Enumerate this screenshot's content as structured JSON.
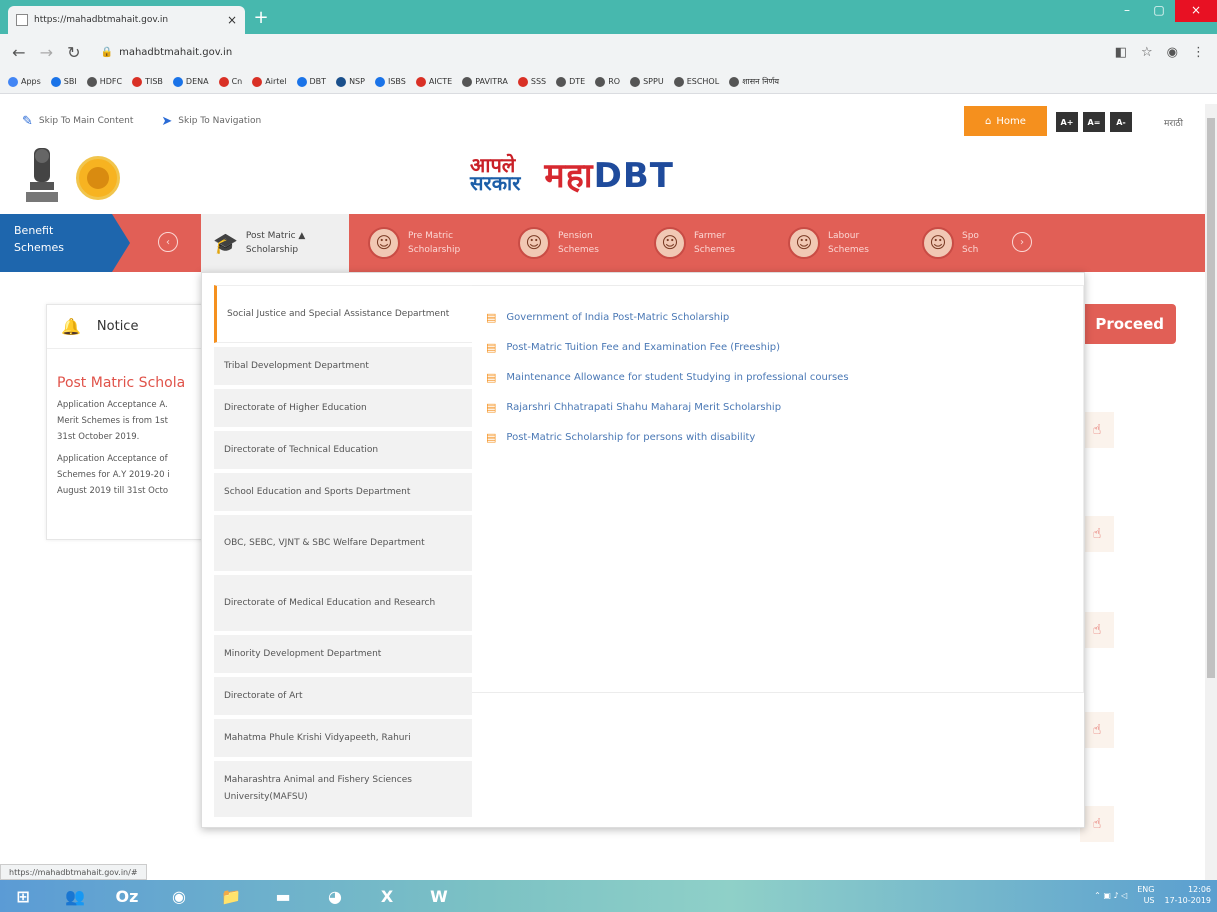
{
  "browser": {
    "tab_title": "https://mahadbtmahait.gov.in",
    "tab_close": "×",
    "new_tab": "+",
    "url": "mahadbtmahait.gov.in",
    "window_controls": [
      "–",
      "▢",
      "×"
    ],
    "bookmarks": [
      {
        "label": "Apps",
        "color": "#4285f4"
      },
      {
        "label": "SBI",
        "color": "#1a73e8"
      },
      {
        "label": "HDFC",
        "color": "#555555"
      },
      {
        "label": "TISB",
        "color": "#d93025"
      },
      {
        "label": "DENA",
        "color": "#1a73e8"
      },
      {
        "label": "Cn",
        "color": "#d93025"
      },
      {
        "label": "Airtel",
        "color": "#d93025"
      },
      {
        "label": "DBT",
        "color": "#1a73e8"
      },
      {
        "label": "NSP",
        "color": "#1a4f8b"
      },
      {
        "label": "ISBS",
        "color": "#1a73e8"
      },
      {
        "label": "AICTE",
        "color": "#d93025"
      },
      {
        "label": "PAVITRA",
        "color": "#555555"
      },
      {
        "label": "SSS",
        "color": "#d93025"
      },
      {
        "label": "DTE",
        "color": "#555555"
      },
      {
        "label": "RO",
        "color": "#555555"
      },
      {
        "label": "SPPU",
        "color": "#555555"
      },
      {
        "label": "ESCHOL",
        "color": "#555555"
      },
      {
        "label": "शासन निर्णय",
        "color": "#555555"
      }
    ],
    "status_url": "https://mahadbtmahait.gov.in/#"
  },
  "site": {
    "skip_main": "Skip To Main Content",
    "skip_nav": "Skip To Navigation",
    "home_label": "Home",
    "font_sizes": [
      "A+",
      "A=",
      "A-"
    ],
    "language": "मराठी",
    "logo_left_1": "आपले",
    "logo_left_2": "सरकार",
    "logo_right_1": "महा",
    "logo_right_2": "DBT"
  },
  "nav": {
    "benefit_line1": "Benefit",
    "benefit_line2": "Schemes",
    "prev": "‹",
    "next": "›",
    "items": [
      {
        "line1": "Post Matric ▲",
        "line2": "Scholarship"
      },
      {
        "line1": "Pre Matric",
        "line2": "Scholarship"
      },
      {
        "line1": "Pension",
        "line2": "Schemes"
      },
      {
        "line1": "Farmer",
        "line2": "Schemes"
      },
      {
        "line1": "Labour",
        "line2": "Schemes"
      },
      {
        "line1": "Spo",
        "line2": "Sch"
      }
    ]
  },
  "notice": {
    "header": "Notice",
    "title": "Post Matric Schola",
    "para1": "Application Acceptance A.\nMerit Schemes is from 1st\n31st October 2019.",
    "para2": "Application Acceptance of\nSchemes for A.Y 2019-20 i\nAugust 2019 till 31st Octo"
  },
  "proceed_label": "Proceed",
  "dropdown": {
    "departments": [
      {
        "label": "Social Justice and Special Assistance Department",
        "height": 58,
        "active": true
      },
      {
        "label": "Tribal Development Department",
        "height": 38
      },
      {
        "label": "Directorate of Higher Education",
        "height": 38
      },
      {
        "label": "Directorate of Technical Education",
        "height": 38
      },
      {
        "label": "School Education and Sports Department",
        "height": 38
      },
      {
        "label": "OBC, SEBC, VJNT & SBC Welfare Department",
        "height": 56
      },
      {
        "label": "Directorate of Medical Education and Research",
        "height": 56
      },
      {
        "label": "Minority Development Department",
        "height": 38
      },
      {
        "label": "Directorate of Art",
        "height": 38
      },
      {
        "label": "Mahatma Phule Krishi Vidyapeeth, Rahuri",
        "height": 38
      },
      {
        "label": "Maharashtra Animal and Fishery Sciences University(MAFSU)",
        "height": 56
      }
    ],
    "schemes": [
      "Government of India Post-Matric Scholarship",
      "Post-Matric Tuition Fee and Examination Fee (Freeship)",
      "Maintenance Allowance for student Studying in professional courses",
      "Rajarshri Chhatrapati Shahu Maharaj Merit Scholarship",
      "Post-Matric Scholarship for persons with disability"
    ]
  },
  "taskbar": {
    "apps": [
      "⊞",
      "👥",
      "Oz",
      "◉",
      "📁",
      "▬",
      "◕",
      "X",
      "W"
    ],
    "lang": "ENG\nUS",
    "time": "12:06",
    "date": "17-10-2019"
  }
}
